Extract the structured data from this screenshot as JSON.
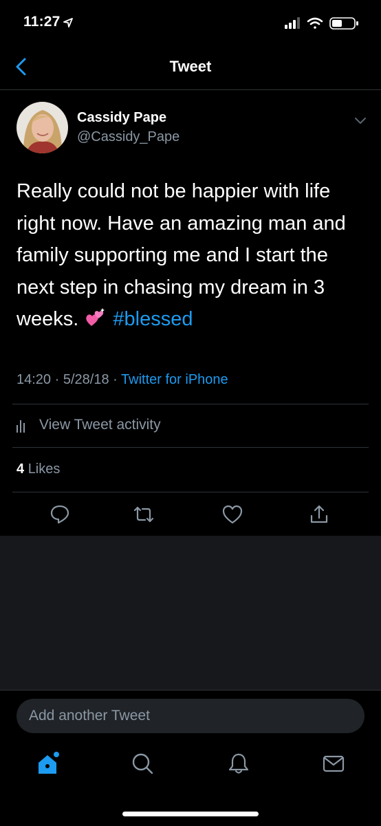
{
  "status_bar": {
    "time": "11:27"
  },
  "nav": {
    "title": "Tweet"
  },
  "tweet": {
    "author_name": "Cassidy Pape",
    "author_handle": "@Cassidy_Pape",
    "text": "Really could not be happier with life right now. Have an amazing man and family supporting me and I start the next step in chasing my dream in 3 weeks.",
    "emoji": "two-hearts",
    "hashtag": "#blessed",
    "time": "14:20",
    "date": "5/28/18",
    "separator": "·",
    "source": "Twitter for iPhone",
    "activity_label": "View Tweet activity",
    "likes_count": "4",
    "likes_label": "Likes"
  },
  "compose": {
    "placeholder": "Add another Tweet"
  },
  "icons": {
    "back": "chevron-left-icon",
    "more": "chevron-down-icon",
    "activity": "bar-chart-icon",
    "reply": "reply-icon",
    "retweet": "retweet-icon",
    "like": "heart-icon",
    "share": "share-icon",
    "home": "home-icon",
    "search": "search-icon",
    "notifications": "bell-icon",
    "messages": "mail-icon"
  },
  "colors": {
    "background": "#000000",
    "accent": "#1d9bf0",
    "secondary_text": "#8b98a5",
    "divider": "#2f3336",
    "panel": "#16181c"
  }
}
